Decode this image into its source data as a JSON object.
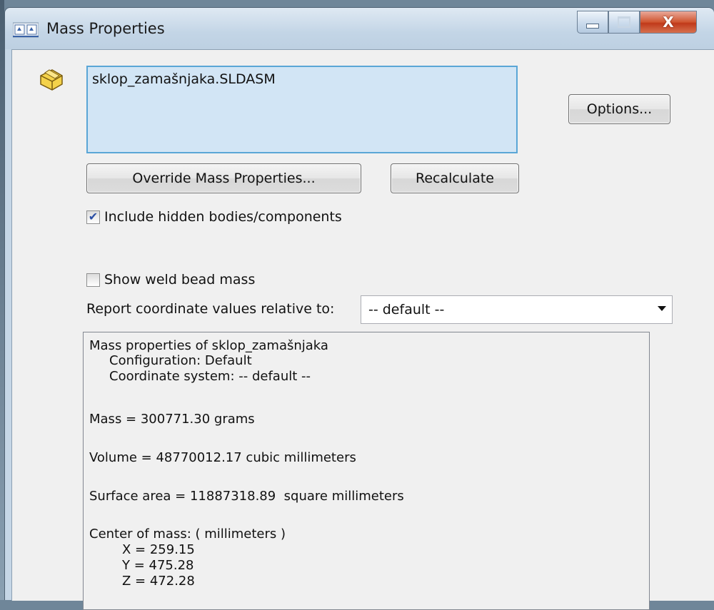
{
  "window": {
    "title": "Mass Properties",
    "caption_buttons": {
      "minimize": "minimize",
      "maximize": "maximize",
      "close": "x"
    }
  },
  "selection": {
    "items": [
      "sklop_zamašnjaka.SLDASM"
    ]
  },
  "buttons": {
    "options": "Options...",
    "override": "Override Mass Properties...",
    "recalculate": "Recalculate"
  },
  "checkboxes": {
    "include_hidden": {
      "label": "Include hidden bodies/components",
      "checked": true
    },
    "show_weld": {
      "label": "Show weld bead mass",
      "checked": false
    }
  },
  "report": {
    "label": "Report coordinate values relative to:",
    "selected": "-- default --"
  },
  "results": {
    "header": "Mass properties of sklop_zamašnjaka",
    "configuration": "Configuration: Default",
    "coordinate_system": "Coordinate system: -- default --",
    "mass": "Mass = 300771.30 grams",
    "volume": "Volume = 48770012.17 cubic millimeters",
    "surface_area": "Surface area = 11887318.89  square millimeters",
    "center_of_mass_label": "Center of mass: ( millimeters )",
    "x": "X = 259.15",
    "y": "Y = 475.28",
    "z": "Z = 472.28"
  },
  "icons": {
    "app": "scale-icon",
    "selection": "assembly-part-icon",
    "close_glyph": "X",
    "checkmark": "✔"
  }
}
